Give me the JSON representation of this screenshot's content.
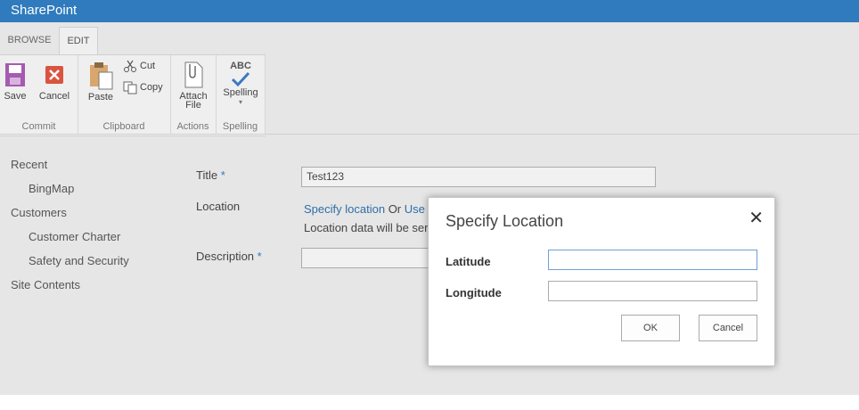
{
  "app": {
    "brand": "SharePoint"
  },
  "tabs": [
    {
      "label": "BROWSE"
    },
    {
      "label": "EDIT"
    }
  ],
  "ribbon": {
    "groups": [
      {
        "label": "Commit",
        "buttons": [
          "Save",
          "Cancel"
        ]
      },
      {
        "label": "Clipboard",
        "buttons": [
          "Paste",
          "Cut",
          "Copy"
        ]
      },
      {
        "label": "Actions",
        "buttons": [
          "Attach File"
        ]
      },
      {
        "label": "Spelling",
        "buttons": [
          "Spelling"
        ]
      }
    ],
    "attach_line1": "Attach",
    "attach_line2": "File",
    "abc_text": "ABC"
  },
  "nav": [
    {
      "label": "Recent"
    },
    {
      "label": "BingMap"
    },
    {
      "label": "Customers"
    },
    {
      "label": "Customer Charter"
    },
    {
      "label": "Safety and Security"
    },
    {
      "label": "Site Contents"
    }
  ],
  "form": {
    "title_label": "Title",
    "title_value": "Test123",
    "location_label": "Location",
    "specify_location_link": "Specify location",
    "or_text": "Or",
    "use_link": "Use",
    "location_note": "Location data will be ser",
    "description_label": "Description",
    "required_marker": "*"
  },
  "dialog": {
    "title": "Specify Location",
    "close_glyph": "✕",
    "latitude_label": "Latitude",
    "longitude_label": "Longitude",
    "latitude_value": "",
    "longitude_value": "",
    "ok_label": "OK",
    "cancel_label": "Cancel"
  },
  "colors": {
    "brand_bar": "#2f7bbd",
    "link": "#2f6ea8",
    "save_icon": "#a45bb0",
    "cancel_icon": "#d9543f"
  }
}
